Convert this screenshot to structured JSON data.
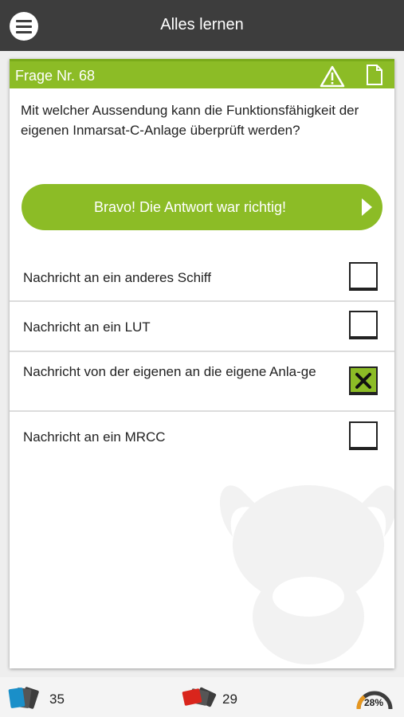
{
  "header": {
    "title": "Alles lernen",
    "menu_icon": "hamburger-menu-icon"
  },
  "card": {
    "question_number_label": "Frage Nr. 68",
    "question_text": "Mit welcher Aussendung kann die Funktionsfähigkeit der eigenen Inmarsat-C-Anlage überprüft werden?",
    "feedback_label": "Bravo! Die Antwort war richtig!",
    "icons": [
      "warning-icon",
      "document-icon"
    ],
    "answers": [
      {
        "label": "Nachricht an ein anderes Schiff",
        "checked": false
      },
      {
        "label": "Nachricht an ein LUT",
        "checked": false
      },
      {
        "label": "Nachricht von der eigenen an die eigene Anla-ge",
        "checked": true
      },
      {
        "label": "Nachricht an ein MRCC",
        "checked": false
      }
    ]
  },
  "footer": {
    "correct_count": "35",
    "wrong_count": "29",
    "progress_label": "28%",
    "progress_fraction": 0.28
  },
  "colors": {
    "accent": "#8cbc26",
    "topbar": "#3d3d3d",
    "blue_cards": "#1a8fc9",
    "red_cards": "#d9251c",
    "progress": "#e6961e"
  }
}
